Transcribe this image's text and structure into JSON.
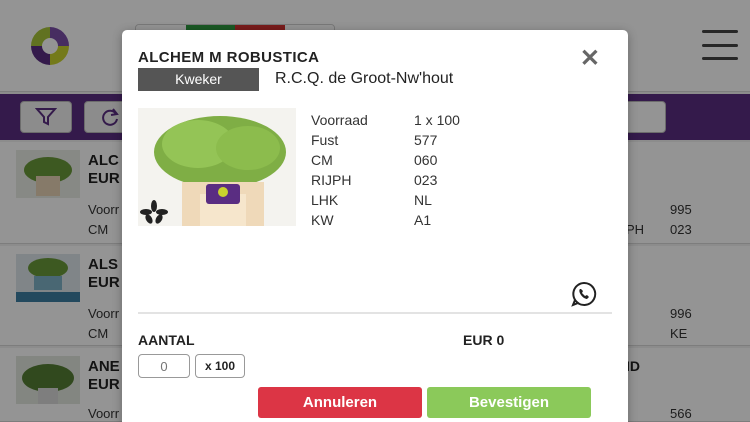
{
  "colors": {
    "brand_purple": "#5a2d82",
    "cancel_red": "#dc3545",
    "confirm_green": "#8bc95a",
    "kweker_gray": "#555555"
  },
  "background": {
    "rows": [
      {
        "name": "ALC\nEUR",
        "meta1": "Voorr",
        "meta2": "CM",
        "right1": "995",
        "right2": "023",
        "mid2": "PH"
      },
      {
        "name": "ALS\nEUR",
        "meta1": "Voorr",
        "meta2": "CM",
        "right1": "996",
        "right2": "KE",
        "mid2": ""
      },
      {
        "name": "ANE\nEUR",
        "meta1": "Voorr",
        "meta2": "",
        "right1": "566",
        "right2": "",
        "mid2": "",
        "tag": "ID"
      }
    ]
  },
  "modal": {
    "title": "ALCHEM M ROBUSTICA",
    "close_icon": "close-icon",
    "kweker_label": "Kweker",
    "kweker_value": "R.C.Q. de Groot-Nw'hout",
    "specs": [
      {
        "label": "Voorraad",
        "value": "1 x 100"
      },
      {
        "label": "Fust",
        "value": "577"
      },
      {
        "label": "CM",
        "value": "060"
      },
      {
        "label": "RIJPH",
        "value": "023"
      },
      {
        "label": "LHK",
        "value": "NL"
      },
      {
        "label": "KW",
        "value": "A1"
      }
    ],
    "aantal_label": "AANTAL",
    "total": "EUR 0",
    "quantity_placeholder": "0",
    "quantity_unit": "x 100",
    "cancel_label": "Annuleren",
    "confirm_label": "Bevestigen"
  }
}
